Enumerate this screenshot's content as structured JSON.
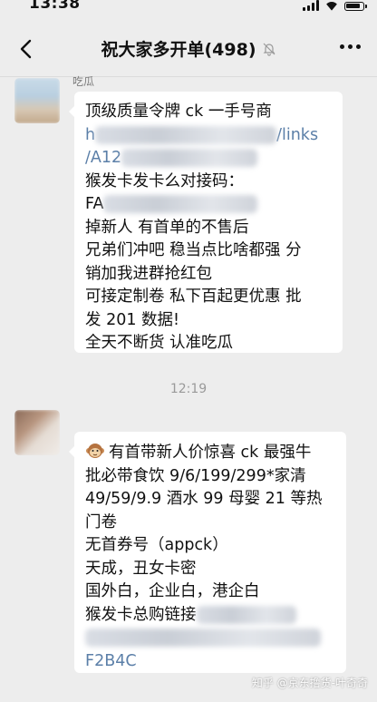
{
  "status_bar": {
    "time": "13:38"
  },
  "nav": {
    "title": "祝大家多开单(498)"
  },
  "messages": [
    {
      "sender": "吃瓜",
      "lines": [
        "顶级质量令牌 ck 一手号商",
        "h",
        "/links",
        "/A12",
        "猴发卡发卡么对接码：",
        "FA",
        "掉新人 有首单的不售后",
        "兄弟们冲吧 稳当点比啥都强 分",
        "销加我进群抢红包",
        "可接定制卷 私下百起更优惠 批",
        "发 201 数据!",
        "全天不断货 认准吃瓜"
      ]
    },
    {
      "sender": "",
      "lines": [
        "有首带新人价惊喜 ck 最强牛",
        "批必带食饮 9/6/199/299*家清",
        "49/59/9.9 酒水 99 母婴 21 等热",
        "门卷",
        "无首券号（appck）",
        "天成，丑女卡密",
        "国外白，企业白，港企白",
        "猴发卡总购链接",
        "F2B4C"
      ]
    }
  ],
  "timestamp": "12:19",
  "watermark": "知乎 @京东撸货-叶奇奇",
  "colors": {
    "background": "#ededed",
    "bubble": "#ffffff",
    "link": "#5b7fa8",
    "muted_text": "#7a7a7a"
  },
  "icons": {
    "back": "chevron-left-icon",
    "mute": "bell-off-icon",
    "more": "more-dots-icon",
    "emoji": "monkey-emoji-icon"
  }
}
